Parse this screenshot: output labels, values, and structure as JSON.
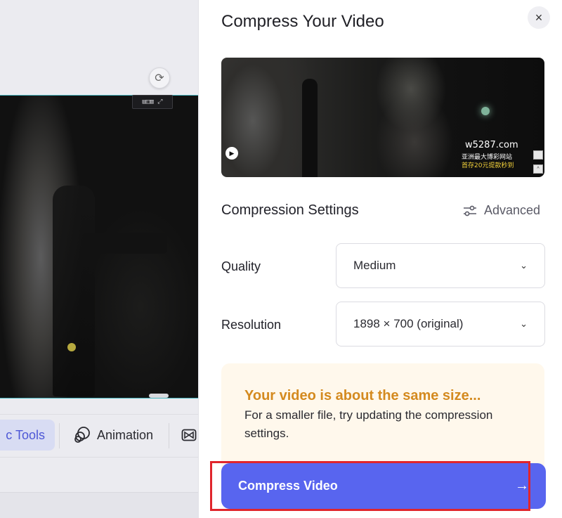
{
  "editor": {
    "toolbar": {
      "magic_tools_label": "c Tools",
      "animation_label": "Animation"
    },
    "mini_toolbar_text": "▤◫▥ ⤢"
  },
  "panel": {
    "title": "Compress Your Video",
    "close_icon": "×",
    "preview": {
      "watermark_domain": "w5287.com",
      "watermark_line1": "亚洲最大博彩网站",
      "watermark_line2": "首存20元提款秒到"
    },
    "settings": {
      "title": "Compression Settings",
      "advanced_label": "Advanced",
      "quality": {
        "label": "Quality",
        "value": "Medium"
      },
      "resolution": {
        "label": "Resolution",
        "value": "1898 × 700 (original)"
      }
    },
    "notice": {
      "title": "Your video is about the same size...",
      "body": "For a smaller file, try updating the compression settings."
    },
    "compress_button": {
      "label": "Compress Video",
      "arrow": "→"
    }
  },
  "colors": {
    "accent": "#5865ef",
    "warning_text": "#d48a1f",
    "notice_bg": "#fff8ec",
    "highlight": "#e0252c"
  }
}
